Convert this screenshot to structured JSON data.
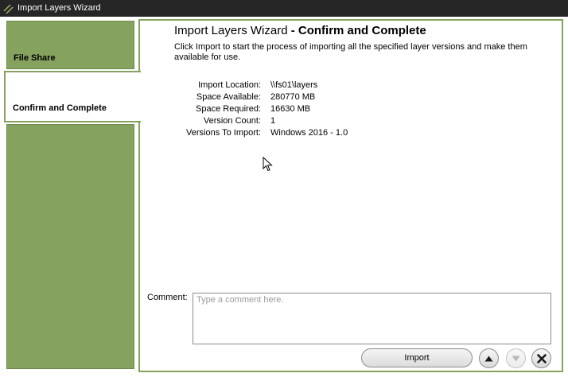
{
  "window": {
    "title": "Import Layers Wizard"
  },
  "nav": {
    "items": [
      {
        "label": "File Share"
      },
      {
        "label": "Confirm and Complete"
      }
    ]
  },
  "page": {
    "heading_prefix": "Import Layers Wizard",
    "heading_suffix": " - Confirm and Complete",
    "intro": "Click Import to start the process of importing all the specified layer versions and make them available for use."
  },
  "details": [
    {
      "label": "Import Location:",
      "value": "\\\\fs01\\layers"
    },
    {
      "label": "Space Available:",
      "value": "280770 MB"
    },
    {
      "label": "Space Required:",
      "value": "16630 MB"
    },
    {
      "label": "Version Count:",
      "value": "1"
    },
    {
      "label": "Versions To Import:",
      "value": "Windows 2016 - 1.0"
    }
  ],
  "comment": {
    "label": "Comment:",
    "value": "",
    "placeholder": "Type a comment here."
  },
  "actions": {
    "import_label": "Import"
  },
  "icons": {
    "logo": "wizard-logo-icon",
    "up": "arrow-up-icon",
    "down": "arrow-down-icon",
    "close": "close-icon",
    "cursor": "mouse-pointer-icon"
  },
  "colors": {
    "accent": "#86a25f",
    "titlebar": "#262626"
  }
}
